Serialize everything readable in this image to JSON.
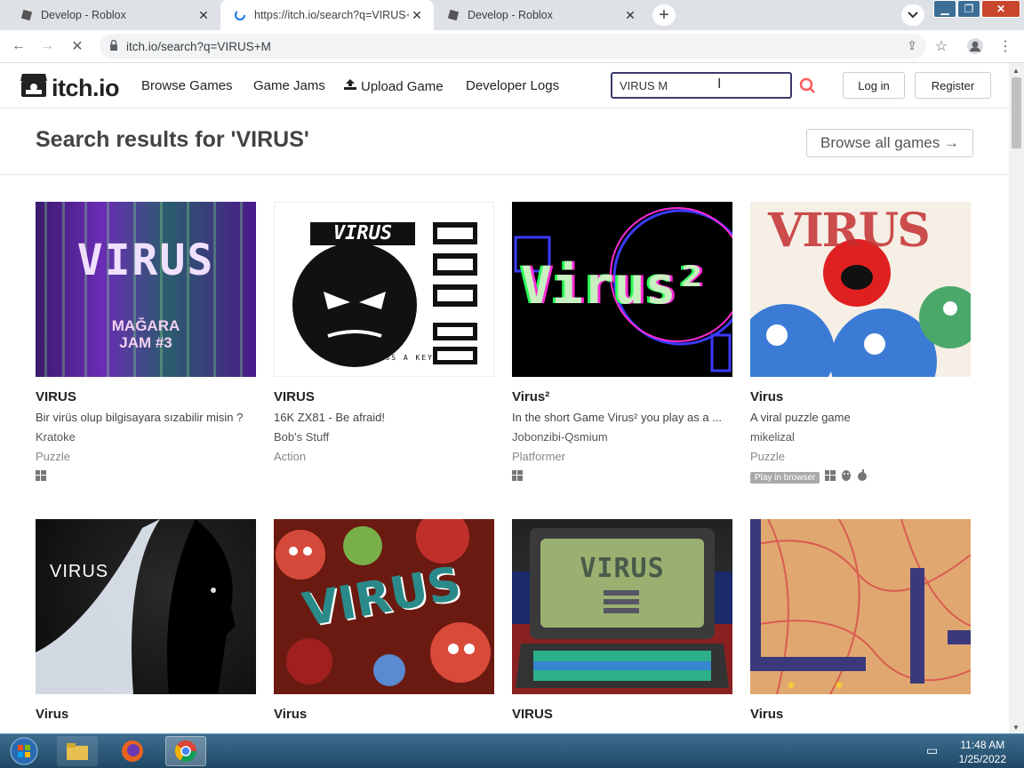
{
  "browser": {
    "tabs": [
      {
        "title": "Develop - Roblox",
        "active": false
      },
      {
        "title": "https://itch.io/search?q=VIRUS+M",
        "active": true
      },
      {
        "title": "Develop - Roblox",
        "active": false
      }
    ],
    "url": "itch.io/search?q=VIRUS+M"
  },
  "site": {
    "logo_text": "itch.io",
    "nav": [
      "Browse Games",
      "Game Jams",
      "Upload Game",
      "Developer Logs"
    ],
    "search_value": "VIRUS M",
    "login_label": "Log in",
    "register_label": "Register"
  },
  "results": {
    "title": "Search results for 'VIRUS'",
    "browse_all": "Browse all games →"
  },
  "games": [
    {
      "title": "VIRUS",
      "desc": "Bir virüs olup bilgisayara sızabilir misin ?",
      "author": "Kratoke",
      "genre": "Puzzle",
      "thumb_text": "VIRUS",
      "thumb_sub": "MAĞARA JAM #3"
    },
    {
      "title": "VIRUS",
      "desc": "16K ZX81 - Be afraid!",
      "author": "Bob's Stuff",
      "genre": "Action",
      "thumb_text": "VIRUS",
      "thumb_sub": "PRESS A KEY"
    },
    {
      "title": "Virus²",
      "desc": "In the short Game Virus² you play as a ...",
      "author": "Jobonzibi-Qsmium",
      "genre": "Platformer",
      "thumb_text": "Virus²",
      "thumb_sub": ""
    },
    {
      "title": "Virus",
      "desc": "A viral puzzle game",
      "author": "mikelizal",
      "genre": "Puzzle",
      "thumb_text": "VIRUS",
      "thumb_sub": "",
      "badge": "Play in browser"
    },
    {
      "title": "Virus",
      "thumb_text": "VIRUS"
    },
    {
      "title": "Virus",
      "thumb_text": "VIRUS"
    },
    {
      "title": "VIRUS",
      "thumb_text": "VIRUS"
    },
    {
      "title": "Virus",
      "thumb_text": ""
    }
  ],
  "taskbar": {
    "time": "11:48 AM",
    "date": "1/25/2022"
  }
}
